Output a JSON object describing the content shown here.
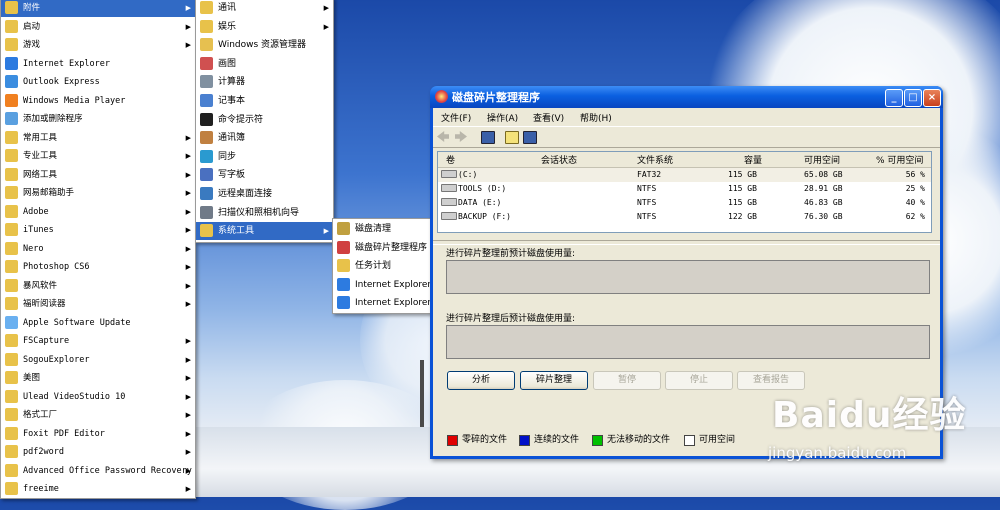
{
  "start_menu": {
    "programs": [
      {
        "label": "附件",
        "icon": "folder-icon",
        "submenu": true,
        "selected": true
      },
      {
        "label": "启动",
        "icon": "folder-icon",
        "submenu": true
      },
      {
        "label": "游戏",
        "icon": "folder-icon",
        "submenu": true
      },
      {
        "label": "Internet Explorer",
        "icon": "ie-icon",
        "submenu": false
      },
      {
        "label": "Outlook Express",
        "icon": "outlook-icon",
        "submenu": false
      },
      {
        "label": "Windows Media Player",
        "icon": "media-player-icon",
        "submenu": false
      },
      {
        "label": "添加或删除程序",
        "icon": "add-remove-icon",
        "submenu": false
      },
      {
        "label": "常用工具",
        "icon": "folder-icon",
        "submenu": true
      },
      {
        "label": "专业工具",
        "icon": "folder-icon",
        "submenu": true
      },
      {
        "label": "网络工具",
        "icon": "folder-icon",
        "submenu": true
      },
      {
        "label": "网易邮箱助手",
        "icon": "folder-icon",
        "submenu": true
      },
      {
        "label": "Adobe",
        "icon": "folder-icon",
        "submenu": true
      },
      {
        "label": "iTunes",
        "icon": "folder-icon",
        "submenu": true
      },
      {
        "label": "Nero",
        "icon": "folder-icon",
        "submenu": true
      },
      {
        "label": "Photoshop CS6",
        "icon": "folder-icon",
        "submenu": true
      },
      {
        "label": "暴风软件",
        "icon": "folder-icon",
        "submenu": true
      },
      {
        "label": "福昕阅读器",
        "icon": "folder-icon",
        "submenu": true
      },
      {
        "label": "Apple Software Update",
        "icon": "apple-update-icon",
        "submenu": false
      },
      {
        "label": "FSCapture",
        "icon": "folder-icon",
        "submenu": true
      },
      {
        "label": "SogouExplorer",
        "icon": "folder-icon",
        "submenu": true
      },
      {
        "label": "美图",
        "icon": "folder-icon",
        "submenu": true
      },
      {
        "label": "Ulead VideoStudio 10",
        "icon": "folder-icon",
        "submenu": true
      },
      {
        "label": "格式工厂",
        "icon": "folder-icon",
        "submenu": true
      },
      {
        "label": "Foxit PDF Editor",
        "icon": "folder-icon",
        "submenu": true
      },
      {
        "label": "pdf2word",
        "icon": "folder-icon",
        "submenu": true
      },
      {
        "label": "Advanced Office Password Recovery",
        "icon": "folder-icon",
        "submenu": true
      },
      {
        "label": "freeime",
        "icon": "folder-icon",
        "submenu": true
      }
    ],
    "accessories": [
      {
        "label": "通讯",
        "icon": "folder-icon",
        "submenu": true
      },
      {
        "label": "娱乐",
        "icon": "folder-icon",
        "submenu": true
      },
      {
        "label": "Windows 资源管理器",
        "icon": "explorer-icon",
        "submenu": false
      },
      {
        "label": "画图",
        "icon": "paint-icon",
        "submenu": false
      },
      {
        "label": "计算器",
        "icon": "calculator-icon",
        "submenu": false
      },
      {
        "label": "记事本",
        "icon": "notepad-icon",
        "submenu": false
      },
      {
        "label": "命令提示符",
        "icon": "cmd-icon",
        "submenu": false
      },
      {
        "label": "通讯簿",
        "icon": "address-book-icon",
        "submenu": false
      },
      {
        "label": "同步",
        "icon": "sync-icon",
        "submenu": false
      },
      {
        "label": "写字板",
        "icon": "wordpad-icon",
        "submenu": false
      },
      {
        "label": "远程桌面连接",
        "icon": "remote-desktop-icon",
        "submenu": false
      },
      {
        "label": "扫描仪和照相机向导",
        "icon": "scanner-icon",
        "submenu": false
      },
      {
        "label": "系统工具",
        "icon": "folder-icon",
        "submenu": true,
        "selected": true
      }
    ],
    "system_tools": [
      {
        "label": "磁盘清理",
        "icon": "disk-cleanup-icon"
      },
      {
        "label": "磁盘碎片整理程序",
        "icon": "defrag-icon"
      },
      {
        "label": "任务计划",
        "icon": "task-scheduler-icon"
      },
      {
        "label": "Internet Explorer (没有加载项)",
        "icon": "ie-icon"
      },
      {
        "label": "Internet Explorer (无加载项)",
        "icon": "ie-icon"
      }
    ]
  },
  "defrag_window": {
    "title": "磁盘碎片整理程序",
    "controls": {
      "minimize": "_",
      "maximize": "□",
      "close": "×"
    },
    "menus": [
      "文件(F)",
      "操作(A)",
      "查看(V)",
      "帮助(H)"
    ],
    "columns": [
      "卷",
      "会话状态",
      "文件系统",
      "容量",
      "可用空间",
      "% 可用空间"
    ],
    "volumes": [
      {
        "name": "(C:)",
        "status": "",
        "fs": "FAT32",
        "capacity": "115 GB",
        "free": "65.08 GB",
        "pct": "56 %"
      },
      {
        "name": "TOOLS (D:)",
        "status": "",
        "fs": "NTFS",
        "capacity": "115 GB",
        "free": "28.91 GB",
        "pct": "25 %"
      },
      {
        "name": "DATA (E:)",
        "status": "",
        "fs": "NTFS",
        "capacity": "115 GB",
        "free": "46.83 GB",
        "pct": "40 %"
      },
      {
        "name": "BACKUP (F:)",
        "status": "",
        "fs": "NTFS",
        "capacity": "122 GB",
        "free": "76.30 GB",
        "pct": "62 %"
      }
    ],
    "before_label": "进行碎片整理前预计磁盘使用量:",
    "after_label": "进行碎片整理后预计磁盘使用量:",
    "buttons": {
      "analyze": "分析",
      "defragment": "碎片整理",
      "pause": "暂停",
      "stop": "停止",
      "report": "查看报告"
    },
    "legend": [
      {
        "label": "零碎的文件",
        "color": "#e00000"
      },
      {
        "label": "连续的文件",
        "color": "#0010c8"
      },
      {
        "label": "无法移动的文件",
        "color": "#00c000"
      },
      {
        "label": "可用空间",
        "color": "#ffffff"
      }
    ]
  },
  "watermark": {
    "brand": "Baidu经验",
    "url": "jingyan.baidu.com"
  }
}
